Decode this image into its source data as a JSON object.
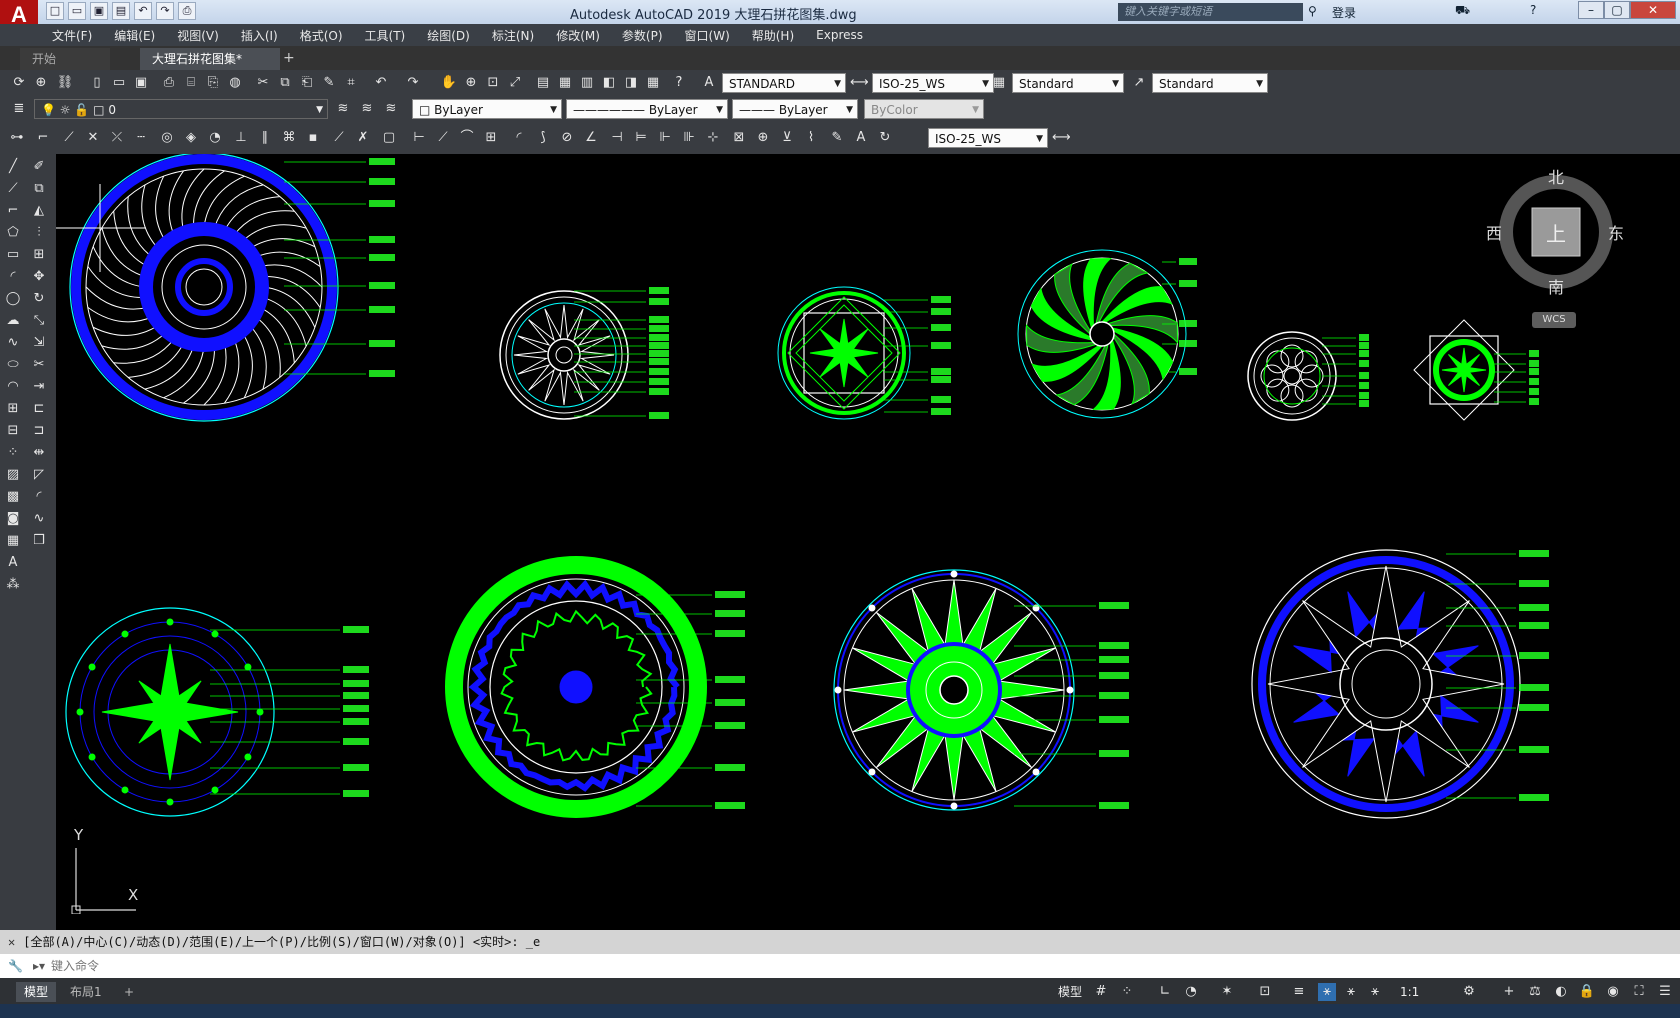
{
  "window": {
    "title": "Autodesk AutoCAD 2019    大理石拼花图集.dwg",
    "app_logo": "A",
    "search_placeholder": "键入关键字或短语",
    "login": "登录"
  },
  "menu": [
    "文件(F)",
    "编辑(E)",
    "视图(V)",
    "插入(I)",
    "格式(O)",
    "工具(T)",
    "绘图(D)",
    "标注(N)",
    "修改(M)",
    "参数(P)",
    "窗口(W)",
    "帮助(H)",
    "Express"
  ],
  "tabs": {
    "start": "开始",
    "drawing": "大理石拼花图集*",
    "add": "+"
  },
  "styles": {
    "text_style": "STANDARD",
    "dim_style": "ISO-25_WS",
    "table_style": "Standard",
    "multileader_style": "Standard",
    "dim_style_2": "ISO-25_WS"
  },
  "layers": {
    "current": "0",
    "color": "ByLayer",
    "linetype": "ByLayer",
    "lineweight": "ByLayer",
    "plotstyle": "ByColor"
  },
  "viewcube": {
    "north": "北",
    "south": "南",
    "east": "东",
    "west": "西",
    "top": "上",
    "wcs": "WCS"
  },
  "ucs": {
    "x": "X",
    "y": "Y"
  },
  "command": {
    "history": "[全部(A)/中心(C)/动态(D)/范围(E)/上一个(P)/比例(S)/窗口(W)/对象(O)] <实时>: _e",
    "placeholder": "键入命令"
  },
  "status": {
    "model_tab": "模型",
    "layout_tab": "布局1",
    "add": "+",
    "model_btn": "模型",
    "scale": "1:1"
  },
  "colors": {
    "cyan": "#00ffff",
    "green": "#00ff00",
    "blue": "#1010ff",
    "white": "#ffffff",
    "label_green": "#22ff22"
  }
}
